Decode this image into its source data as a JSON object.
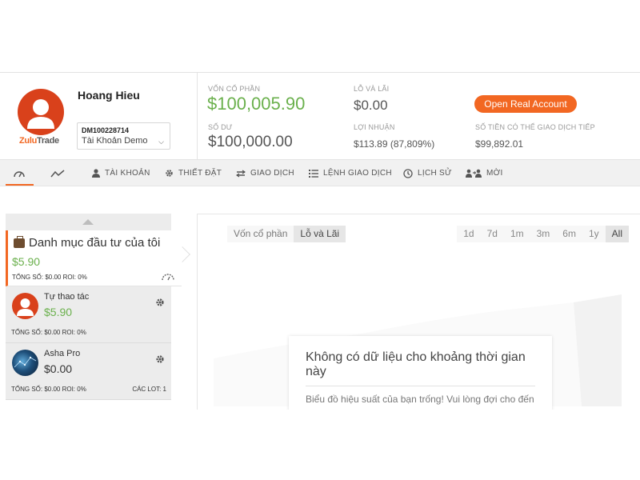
{
  "account": {
    "brand_part1": "Zulu",
    "brand_part2": "Trade",
    "user_name": "Hoang Hieu",
    "account_id": "DM100228714",
    "account_type": "Tài Khoản Demo"
  },
  "stats": {
    "equity_label": "Vốn cổ phần",
    "equity_value": "$100,005.90",
    "balance_label": "Số dư",
    "balance_value": "$100,000.00",
    "pl_label": "Lỗ và lãi",
    "pl_value": "$0.00",
    "profit_label": "Lợi nhuận",
    "profit_value": "$113.89 (87,809%)",
    "free_margin_label": "Số tiền có thể giao dịch tiếp",
    "free_margin_value": "$99,892.01",
    "open_real_label": "Open Real Account"
  },
  "nav": {
    "items": [
      {
        "label": "",
        "icon": "dashboard-icon"
      },
      {
        "label": "",
        "icon": "chart-line-icon"
      },
      {
        "label": "TÀI KHOẢN",
        "icon": "user-icon"
      },
      {
        "label": "THIẾT ĐẶT",
        "icon": "gear-icon"
      },
      {
        "label": "GIAO DỊCH",
        "icon": "swap-icon"
      },
      {
        "label": "LỆNH GIAO DỊCH",
        "icon": "list-icon"
      },
      {
        "label": "LỊCH SỬ",
        "icon": "history-icon"
      },
      {
        "label": "MỜI",
        "icon": "invite-icon"
      }
    ]
  },
  "portfolio": {
    "title": "Danh mục đầu tư của tôi",
    "amount": "$5.90",
    "info": "TỔNG SỐ: $0.00 ROI: 0%"
  },
  "strategies": [
    {
      "name": "Tự thao tác",
      "amount": "$5.90",
      "info": "TỔNG SỐ: $0.00 ROI: 0%",
      "lots": ""
    },
    {
      "name": "Asha Pro",
      "amount": "$0.00",
      "info": "TỔNG SỐ: $0.00 ROI: 0%",
      "lots": "CÁC LOT: 1"
    }
  ],
  "chart_panel": {
    "tabs": [
      "Vốn cổ phần",
      "Lỗ và Lãi"
    ],
    "active_tab": "Lỗ và Lãi",
    "ranges": [
      "1d",
      "7d",
      "1m",
      "3m",
      "6m",
      "1y",
      "All"
    ],
    "active_range": "All",
    "no_data_title": "Không có dữ liệu cho khoảng thời gian này",
    "no_data_text": "Biểu đồ hiệu suất của bạn trống! Vui lòng đợi cho đến"
  },
  "colors": {
    "accent": "#f26722",
    "positive": "#6ab04c",
    "avatar_red": "#d9411b"
  }
}
